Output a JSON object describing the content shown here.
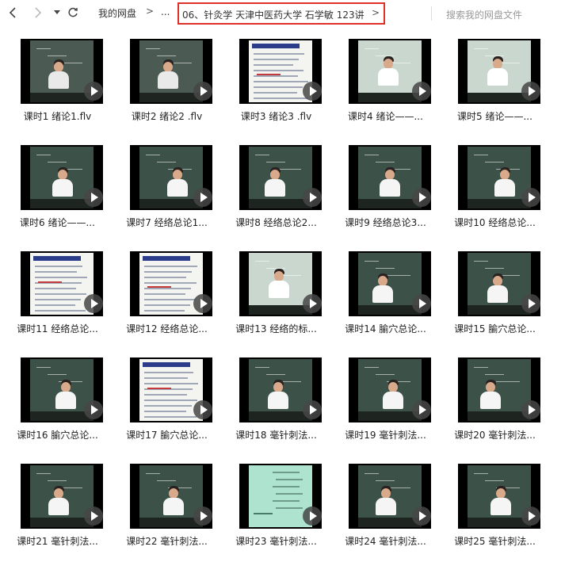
{
  "toolbar": {
    "back_icon": "chevron-left-icon",
    "forward_icon": "chevron-right-icon",
    "history_icon": "dropdown-caret-icon",
    "refresh_icon": "refresh-icon",
    "root_crumb": "我的网盘",
    "sep1": ">",
    "ellipsis": "...",
    "current_folder": "06、针灸学 天津中医药大学 石学敏 123讲",
    "current_sep": ">",
    "search_placeholder": "搜索我的网盘文件",
    "highlight_color": "#e0302a"
  },
  "files": [
    {
      "name": "课时1 绪论1.flv",
      "thumb": "lecturer"
    },
    {
      "name": "课时2 绪论2 .flv",
      "thumb": "lecturer"
    },
    {
      "name": "课时3 绪论3 .flv",
      "thumb": "slide"
    },
    {
      "name": "课时4 绪论——...",
      "thumb": "teacher"
    },
    {
      "name": "课时5 绪论——...",
      "thumb": "teacher"
    },
    {
      "name": "课时6 绪论——...",
      "thumb": "board"
    },
    {
      "name": "课时7 经络总论1...",
      "thumb": "board"
    },
    {
      "name": "课时8 经络总论2...",
      "thumb": "board"
    },
    {
      "name": "课时9 经络总论3...",
      "thumb": "board"
    },
    {
      "name": "课时10 经络总论...",
      "thumb": "board"
    },
    {
      "name": "课时11 经络总论...",
      "thumb": "slide"
    },
    {
      "name": "课时12 经络总论...",
      "thumb": "slide"
    },
    {
      "name": "课时13 经络的标...",
      "thumb": "teacher"
    },
    {
      "name": "课时14 腧穴总论...",
      "thumb": "board"
    },
    {
      "name": "课时15 腧穴总论...",
      "thumb": "board"
    },
    {
      "name": "课时16 腧穴总论...",
      "thumb": "board"
    },
    {
      "name": "课时17 腧穴总论...",
      "thumb": "slide"
    },
    {
      "name": "课时18 毫针刺法...",
      "thumb": "board"
    },
    {
      "name": "课时19 毫针刺法...",
      "thumb": "board"
    },
    {
      "name": "课时20 毫针刺法...",
      "thumb": "board"
    },
    {
      "name": "课时21 毫针刺法...",
      "thumb": "board"
    },
    {
      "name": "课时22 毫针刺法...",
      "thumb": "board"
    },
    {
      "name": "课时23 毫针刺法...",
      "thumb": "mint"
    },
    {
      "name": "课时24 毫针刺法...",
      "thumb": "board"
    },
    {
      "name": "课时25 毫针刺法...",
      "thumb": "board"
    }
  ],
  "play_icon": "play-icon"
}
